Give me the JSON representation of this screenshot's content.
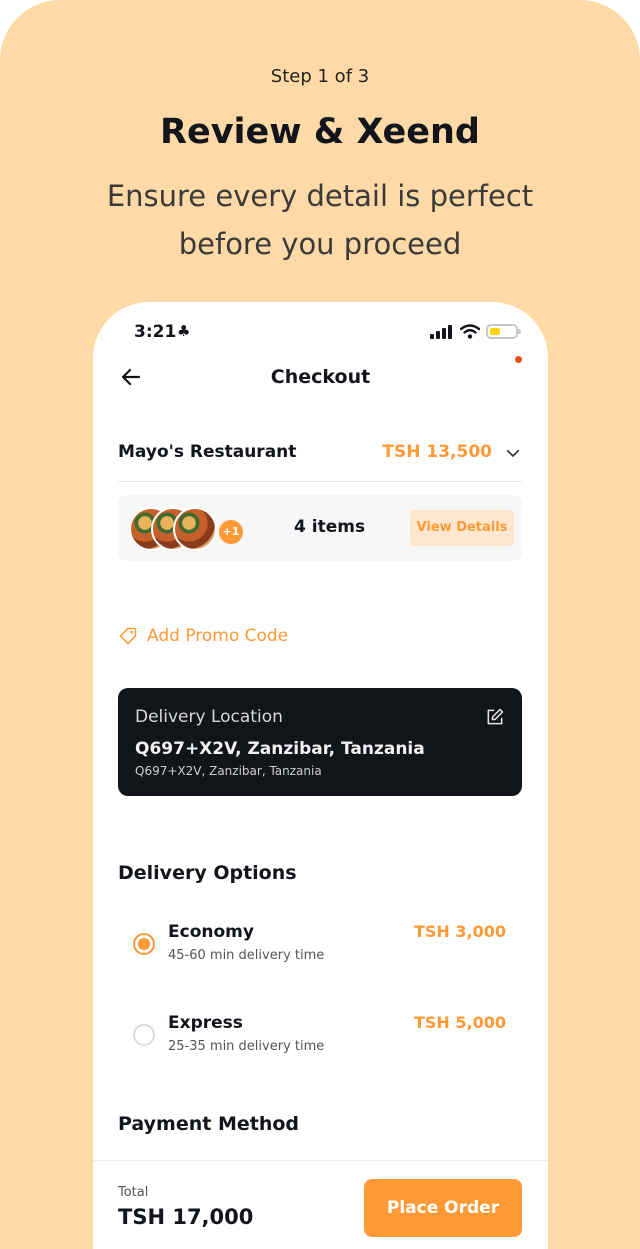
{
  "promo": {
    "step": "Step 1 of 3",
    "headline": "Review & Xeend",
    "subline_1": "Ensure every detail is perfect",
    "subline_2": "before you proceed"
  },
  "status_bar": {
    "time": "3:21",
    "time_glyph": "♣"
  },
  "header": {
    "title": "Checkout",
    "back_icon": "arrow-left-icon"
  },
  "restaurant": {
    "name": "Mayo's Restaurant",
    "price": "TSH 13,500",
    "expand_icon": "chevron-down-icon"
  },
  "items": {
    "extra_badge": "+1",
    "count_label": "4 items",
    "view_details_label": "View Details"
  },
  "promo_code": {
    "label": "Add Promo Code",
    "icon": "tag-icon"
  },
  "delivery_location": {
    "label": "Delivery Location",
    "title": "Q697+X2V, Zanzibar, Tanzania",
    "subtitle": "Q697+X2V, Zanzibar, Tanzania",
    "edit_icon": "edit-icon"
  },
  "delivery_options": {
    "title": "Delivery Options",
    "options": [
      {
        "name": "Economy",
        "time": "45-60 min delivery time",
        "price": "TSH 3,000",
        "selected": true
      },
      {
        "name": "Express",
        "time": "25-35 min delivery time",
        "price": "TSH 5,000",
        "selected": false
      }
    ]
  },
  "payment": {
    "title": "Payment Method"
  },
  "footer": {
    "total_label": "Total",
    "total_value": "TSH 17,000",
    "place_order_label": "Place Order"
  },
  "colors": {
    "accent": "#ff9a36",
    "background": "#ffd9a6",
    "dark_card": "#111418"
  }
}
